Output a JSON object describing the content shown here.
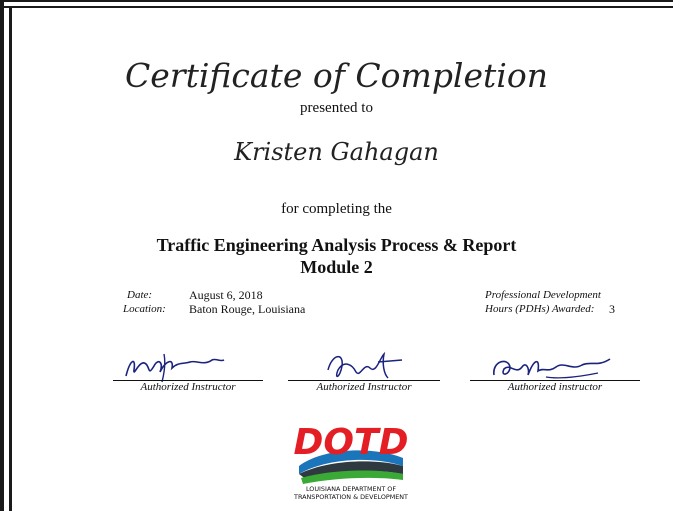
{
  "certificate": {
    "title": "Certificate of Completion",
    "presented_to": "presented to",
    "recipient": "Kristen Gahagan",
    "for_completing": "for completing the",
    "course_line1": "Traffic Engineering Analysis Process & Report",
    "course_line2": "Module 2"
  },
  "details": {
    "date_label": "Date:",
    "date_value": "August 6, 2018",
    "location_label": "Location:",
    "location_value": "Baton Rouge, Louisiana",
    "pdh_label_line1": "Professional Development",
    "pdh_label_line2": "Hours (PDHs) Awarded:",
    "pdh_value": "3"
  },
  "signatures": [
    {
      "label": "Authorized Instructor"
    },
    {
      "label": "Authorized Instructor"
    },
    {
      "label": "Authorized instructor"
    }
  ],
  "logo": {
    "text": "DOTD",
    "line1": "LOUISIANA DEPARTMENT OF",
    "line2": "TRANSPORTATION & DEVELOPMENT",
    "colors": {
      "red": "#e31e24",
      "blue": "#1b75bb",
      "green": "#3aa935",
      "road": "#2e3a3f"
    }
  }
}
